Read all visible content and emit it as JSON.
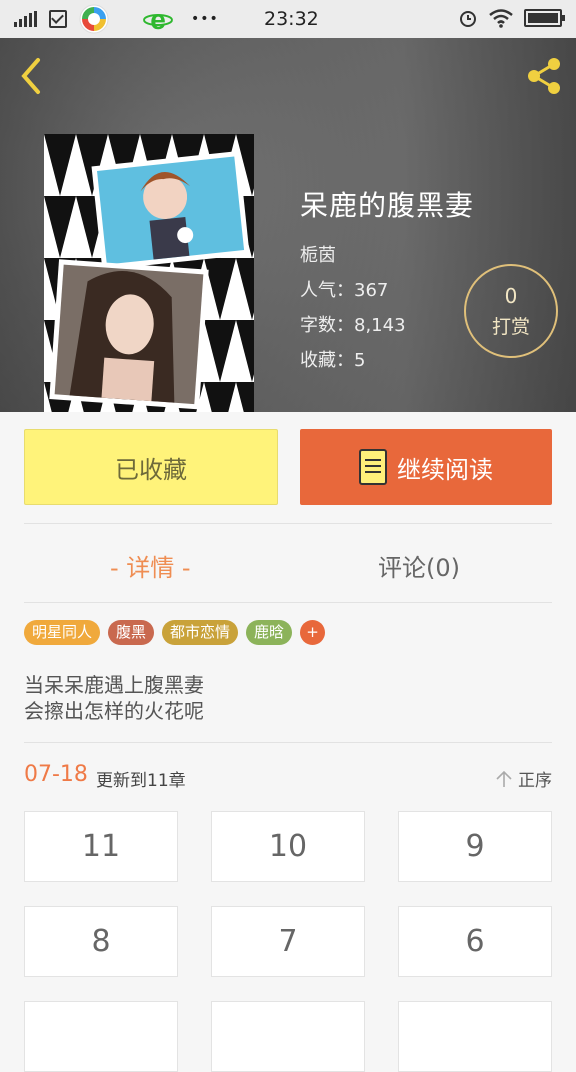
{
  "status_bar": {
    "time": "23:32",
    "icons": [
      "signal-icon",
      "checkbox-icon",
      "qq-browser-icon",
      "ie-browser-icon",
      "more-dots-icon",
      "alarm-icon",
      "wifi-icon",
      "battery-icon"
    ]
  },
  "book": {
    "title": "呆鹿的腹黑妻",
    "author": "栀茵",
    "popularity": "人气：367",
    "word_count": "字数：8,143",
    "favorites": "收藏：5"
  },
  "tip": {
    "count": "0",
    "label": "打赏"
  },
  "actions": {
    "favorited_label": "已收藏",
    "continue_label": "继续阅读"
  },
  "tabs": [
    {
      "label": "- 详情 -"
    },
    {
      "label": "评论(0)"
    }
  ],
  "tags": [
    {
      "label": "明星同人",
      "color": "#f0a93c"
    },
    {
      "label": "腹黑",
      "color": "#c9694f"
    },
    {
      "label": "都市恋情",
      "color": "#c9a23a"
    },
    {
      "label": "鹿晗",
      "color": "#8cb35a"
    },
    {
      "label": "+",
      "color": "#e8683b"
    }
  ],
  "description": [
    "当呆呆鹿遇上腹黑妻",
    "会擦出怎样的火花呢"
  ],
  "update": {
    "date": "07-18",
    "text": "更新到11章",
    "sort_label": "正序"
  },
  "chapters": [
    "11",
    "10",
    "9",
    "8",
    "7",
    "6",
    "",
    "",
    ""
  ],
  "colors": {
    "accent": "#e8683b",
    "fav_button": "#fff37a",
    "tab_active": "#ef8d52"
  }
}
